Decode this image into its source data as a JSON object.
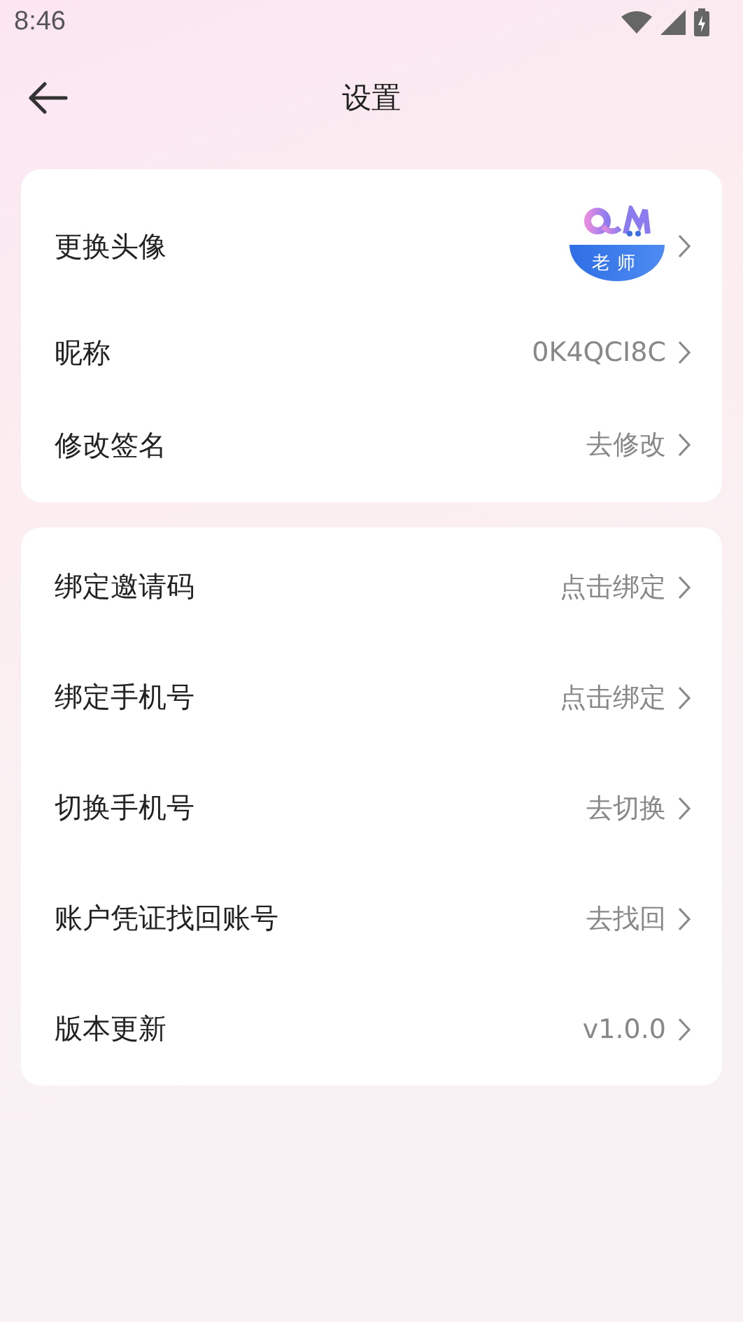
{
  "status_bar": {
    "time": "8:46"
  },
  "header": {
    "title": "设置"
  },
  "profile": {
    "avatar_label": "老师",
    "rows": [
      {
        "kind": "avatar",
        "label": "更换头像"
      },
      {
        "kind": "value",
        "label": "昵称",
        "value": "0K4QCI8C"
      },
      {
        "kind": "value",
        "label": "修改签名",
        "value": "去修改"
      }
    ]
  },
  "account": {
    "rows": [
      {
        "kind": "value",
        "label": "绑定邀请码",
        "value": "点击绑定"
      },
      {
        "kind": "value",
        "label": "绑定手机号",
        "value": "点击绑定"
      },
      {
        "kind": "value",
        "label": "切换手机号",
        "value": "去切换"
      },
      {
        "kind": "value",
        "label": "账户凭证找回账号",
        "value": "去找回"
      },
      {
        "kind": "value",
        "label": "版本更新",
        "value": "v1.0.0"
      }
    ]
  }
}
